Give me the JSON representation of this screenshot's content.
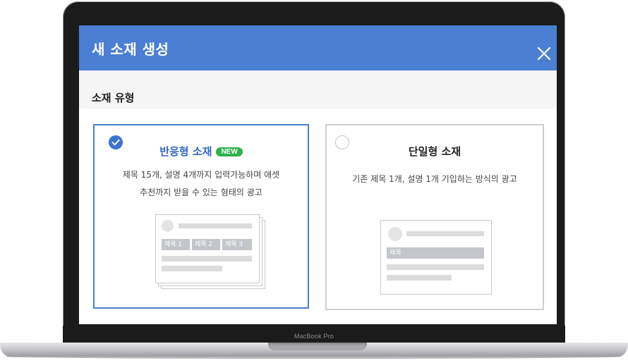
{
  "laptop": {
    "model_label": "MacBook Pro"
  },
  "modal": {
    "title": "새 소재 생성",
    "section_title": "소재 유형",
    "accent_color": "#4a7fd4"
  },
  "options": [
    {
      "title": "반응형 소재",
      "badge": "NEW",
      "desc_line1": "제목 15개, 설명 4개까지 입력가능하며 애셋",
      "desc_line2": "추천까지 받을 수 있는 형태의 광고",
      "selected": true,
      "chips": [
        "제목 1",
        "제목 2",
        "제목 3"
      ]
    },
    {
      "title": "단일형 소재",
      "desc_line1": "기존 제목 1개, 설명 1개 기입하는 방식의 광고",
      "selected": false,
      "chip": "제목"
    }
  ]
}
